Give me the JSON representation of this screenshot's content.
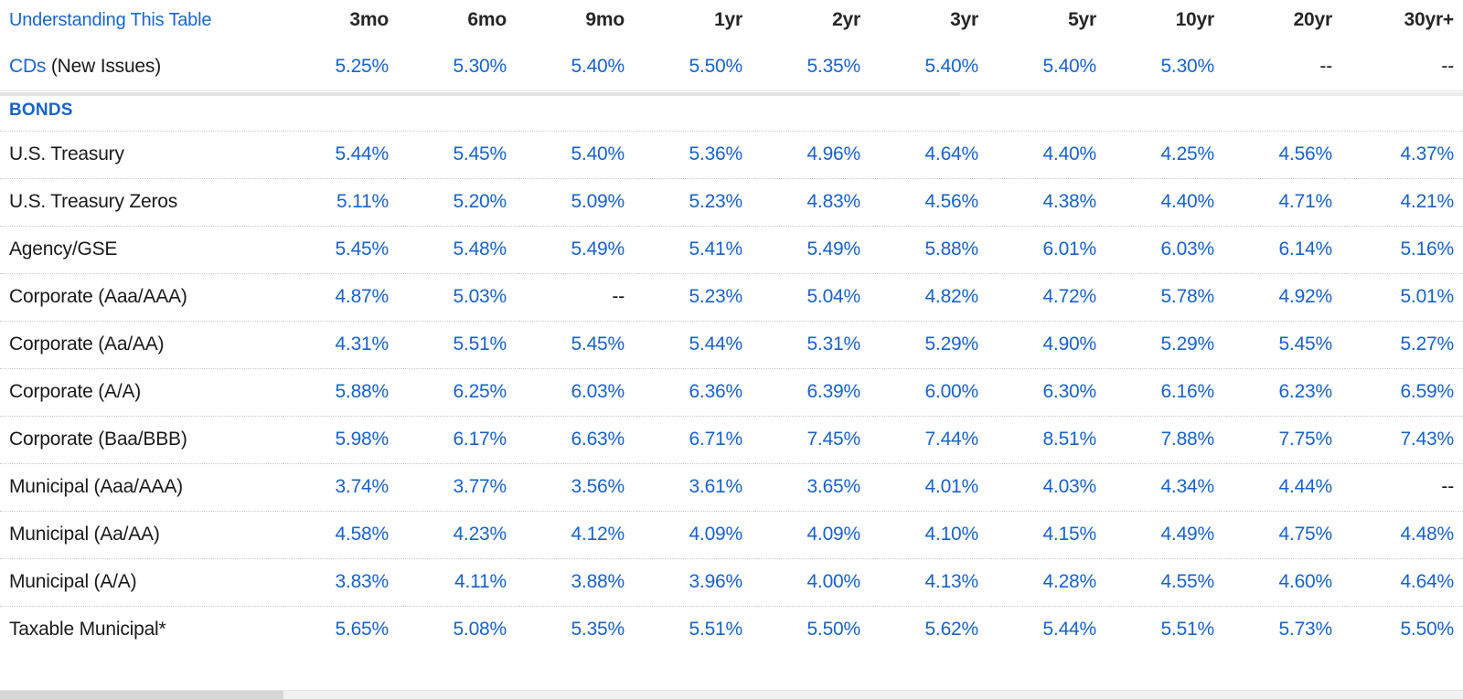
{
  "colors": {
    "link_blue": "#1a66d0",
    "rate_blue": "#1763cf",
    "text_black": "#1a1a1a",
    "header_black": "#262626",
    "rule_gray": "#e3e3e3",
    "dotted_gray": "#c9c9c9",
    "scrollbar_thumb": "#d7d7d7",
    "scrollbar_track": "#f1f1f1"
  },
  "header": {
    "understanding_link": "Understanding This Table",
    "columns": [
      "3mo",
      "6mo",
      "9mo",
      "1yr",
      "2yr",
      "3yr",
      "5yr",
      "10yr",
      "20yr",
      "30yr+"
    ]
  },
  "cds_row": {
    "link_label": "CDs",
    "suffix_label": " (New Issues)",
    "rates": [
      "5.25%",
      "5.30%",
      "5.40%",
      "5.50%",
      "5.35%",
      "5.40%",
      "5.40%",
      "5.30%",
      "--",
      "--"
    ]
  },
  "section": {
    "bonds_label": "BONDS"
  },
  "rows": [
    {
      "label": "U.S. Treasury",
      "rates": [
        "5.44%",
        "5.45%",
        "5.40%",
        "5.36%",
        "4.96%",
        "4.64%",
        "4.40%",
        "4.25%",
        "4.56%",
        "4.37%"
      ]
    },
    {
      "label": "U.S. Treasury Zeros",
      "rates": [
        "5.11%",
        "5.20%",
        "5.09%",
        "5.23%",
        "4.83%",
        "4.56%",
        "4.38%",
        "4.40%",
        "4.71%",
        "4.21%"
      ]
    },
    {
      "label": "Agency/GSE",
      "rates": [
        "5.45%",
        "5.48%",
        "5.49%",
        "5.41%",
        "5.49%",
        "5.88%",
        "6.01%",
        "6.03%",
        "6.14%",
        "5.16%"
      ]
    },
    {
      "label": "Corporate (Aaa/AAA)",
      "rates": [
        "4.87%",
        "5.03%",
        "--",
        "5.23%",
        "5.04%",
        "4.82%",
        "4.72%",
        "5.78%",
        "4.92%",
        "5.01%"
      ]
    },
    {
      "label": "Corporate (Aa/AA)",
      "rates": [
        "4.31%",
        "5.51%",
        "5.45%",
        "5.44%",
        "5.31%",
        "5.29%",
        "4.90%",
        "5.29%",
        "5.45%",
        "5.27%"
      ]
    },
    {
      "label": "Corporate (A/A)",
      "rates": [
        "5.88%",
        "6.25%",
        "6.03%",
        "6.36%",
        "6.39%",
        "6.00%",
        "6.30%",
        "6.16%",
        "6.23%",
        "6.59%"
      ]
    },
    {
      "label": "Corporate (Baa/BBB)",
      "rates": [
        "5.98%",
        "6.17%",
        "6.63%",
        "6.71%",
        "7.45%",
        "7.44%",
        "8.51%",
        "7.88%",
        "7.75%",
        "7.43%"
      ]
    },
    {
      "label": "Municipal (Aaa/AAA)",
      "rates": [
        "3.74%",
        "3.77%",
        "3.56%",
        "3.61%",
        "3.65%",
        "4.01%",
        "4.03%",
        "4.34%",
        "4.44%",
        "--"
      ]
    },
    {
      "label": "Municipal (Aa/AA)",
      "rates": [
        "4.58%",
        "4.23%",
        "4.12%",
        "4.09%",
        "4.09%",
        "4.10%",
        "4.15%",
        "4.49%",
        "4.75%",
        "4.48%"
      ]
    },
    {
      "label": "Municipal (A/A)",
      "rates": [
        "3.83%",
        "4.11%",
        "3.88%",
        "3.96%",
        "4.00%",
        "4.13%",
        "4.28%",
        "4.55%",
        "4.60%",
        "4.64%"
      ]
    },
    {
      "label": "Taxable Municipal*",
      "rates": [
        "5.65%",
        "5.08%",
        "5.35%",
        "5.51%",
        "5.50%",
        "5.62%",
        "5.44%",
        "5.51%",
        "5.73%",
        "5.50%"
      ]
    }
  ],
  "na_marker": "--"
}
